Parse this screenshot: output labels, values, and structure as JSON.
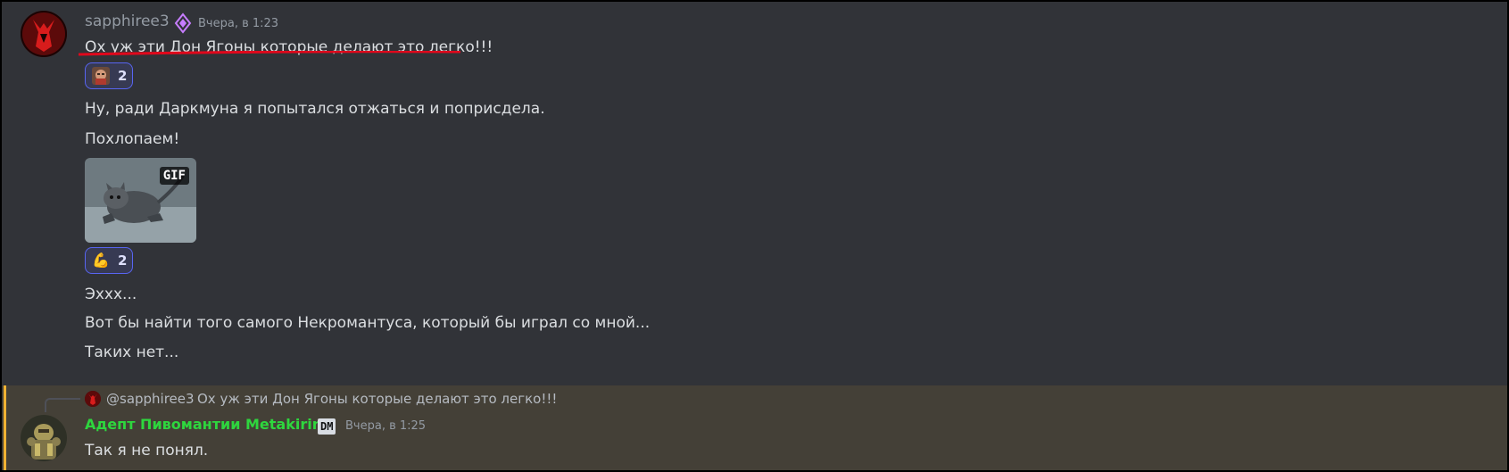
{
  "message_group_1": {
    "author": "sapphiree3",
    "role_icon": "diamond-role-icon",
    "timestamp": "Вчера, в 1:23",
    "lines": [
      "Ох уж эти Дон Ягоны которые делают это легко!!!",
      "Ну, ради Даркмуна я попытался отжаться и поприсдела.",
      "Похлопаем!",
      "Эххх...",
      "Вот бы найти того самого Некромантуса, который бы играл со мной...",
      "Таких нет..."
    ],
    "reactions": [
      {
        "emoji": "face-avatar-emoji",
        "count": "2"
      },
      {
        "emoji": "💪",
        "count": "2"
      }
    ],
    "gif": {
      "badge": "GIF",
      "subject": "kitten"
    },
    "highlight_color": "#e0081c"
  },
  "message_group_2": {
    "reply": {
      "author": "@sapphiree3",
      "text": "Ох уж эти Дон Ягоны которые делают это легко!!!"
    },
    "author": "Адепт Пивомантии Metakirin",
    "author_color": "#2ed63e",
    "badge": "DM",
    "timestamp": "Вчера, в 1:25",
    "text": "Так я не понял.",
    "mention_highlight": "#f0b232"
  }
}
